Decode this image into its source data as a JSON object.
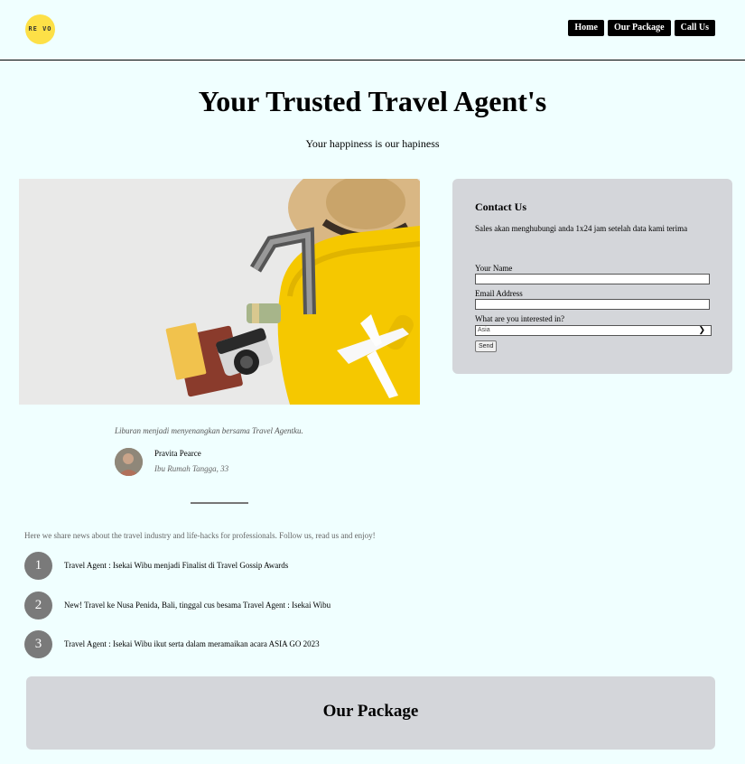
{
  "header": {
    "logo_text": "RE VO",
    "nav": [
      "Home",
      "Our Package",
      "Call Us"
    ]
  },
  "hero": {
    "title": "Your Trusted Travel Agent's",
    "subtitle": "Your happiness is our hapiness"
  },
  "contact": {
    "title": "Contact Us",
    "description": "Sales akan menghubungi anda 1x24 jam setelah data kami terima",
    "name_label": "Your Name",
    "email_label": "Email Address",
    "interest_label": "What are you interested in?",
    "interest_selected": "Asia",
    "send_label": "Send"
  },
  "testimonial": {
    "quote": "Liburan menjadi menyenangkan bersama Travel Agentku.",
    "name": "Pravita Pearce",
    "role": "Ibu Rumah Tangga, 33"
  },
  "news": {
    "intro": "Here we share news about the travel industry and life-hacks for professionals. Follow us, read us and enjoy!",
    "items": [
      {
        "num": "1",
        "text": "Travel Agent : Isekai Wibu menjadi Finalist di Travel Gossip Awards"
      },
      {
        "num": "2",
        "text": "New! Travel ke Nusa Penida, Bali, tinggal cus besama Travel Agent : Isekai Wibu"
      },
      {
        "num": "3",
        "text": "Travel Agent : Isekai Wibu ikut serta dalam meramaikan acara ASIA GO 2023"
      }
    ]
  },
  "package": {
    "title": "Our Package"
  },
  "colors": {
    "background": "#f0ffff",
    "card": "#d4d6da",
    "nav_button": "#000000",
    "logo": "#fde047"
  }
}
